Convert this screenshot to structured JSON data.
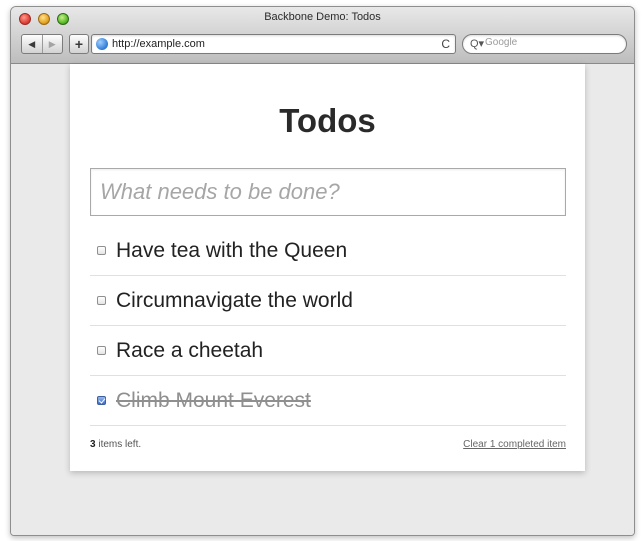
{
  "window": {
    "title": "Backbone Demo: Todos"
  },
  "toolbar": {
    "back_icon": "◀",
    "forward_icon": "▶",
    "add_icon": "+",
    "url": "http://example.com",
    "reload_icon": "C",
    "search_placeholder": "Google",
    "search_icon": "Q▾"
  },
  "app": {
    "title": "Todos",
    "new_todo_placeholder": "What needs to be done?",
    "todos": [
      {
        "text": "Have tea with the Queen",
        "done": false
      },
      {
        "text": "Circumnavigate the world",
        "done": false
      },
      {
        "text": "Race a cheetah",
        "done": false
      },
      {
        "text": "Climb Mount Everest",
        "done": true
      }
    ],
    "footer": {
      "count": "3",
      "count_suffix": " items left.",
      "clear_label": "Clear 1 completed item"
    }
  },
  "colors": {
    "page_bg": "#eaeaea",
    "app_bg": "#ffffff",
    "checkbox_checked": "#3a6fcf"
  }
}
